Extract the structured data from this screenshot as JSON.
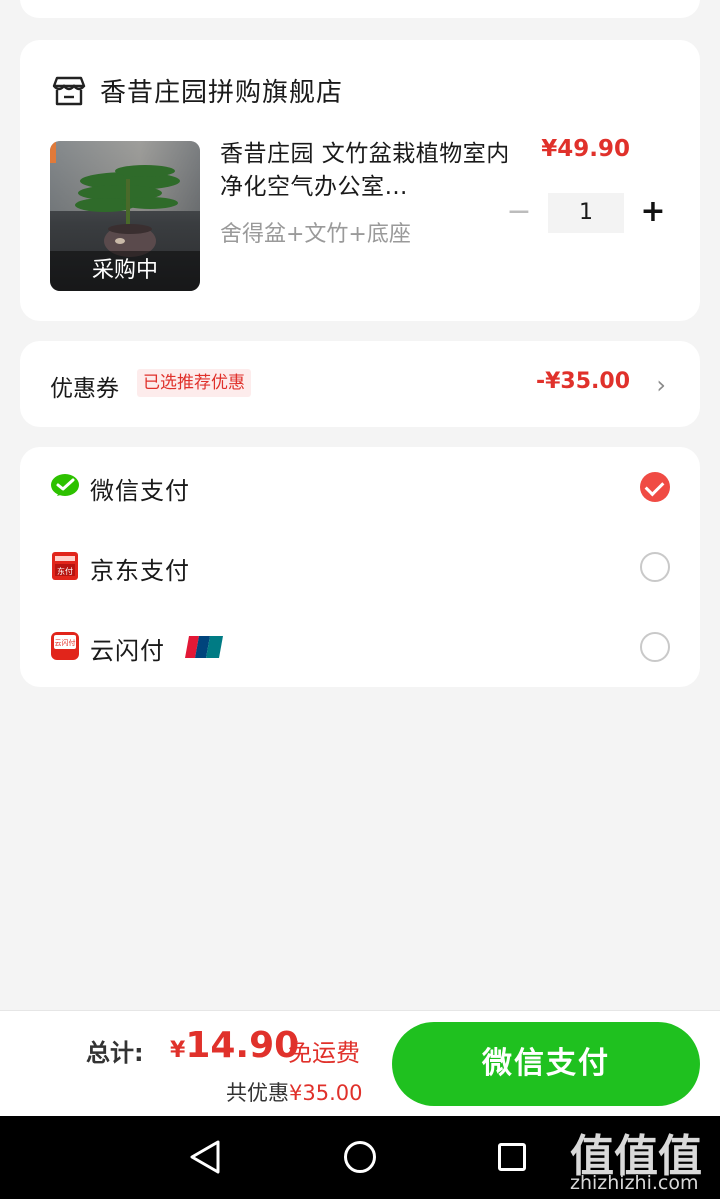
{
  "store": {
    "name": "香昔庄园拼购旗舰店",
    "product": {
      "title": "香昔庄园 文竹盆栽植物室内净化空气办公室…",
      "spec": "舍得盆+文竹+底座",
      "price": "¥49.90",
      "thumb_label": "采购中",
      "quantity": "1",
      "minus_symbol": "−",
      "plus_symbol": "+"
    }
  },
  "coupon": {
    "label": "优惠券",
    "badge": "已选推荐优惠",
    "amount": "-¥35.00",
    "chevron": "›"
  },
  "payment_methods": [
    {
      "label": "微信支付",
      "icon": "wechat-pay-icon",
      "selected": true
    },
    {
      "label": "京东支付",
      "icon": "jd-pay-icon",
      "selected": false
    },
    {
      "label": "云闪付",
      "icon": "cloud-quickpass-icon",
      "selected": false,
      "extra_icon": "unionpay-icon"
    }
  ],
  "footer": {
    "total_label": "总计:",
    "currency": "¥",
    "total_amount": "14.90",
    "free_shipping": "免运费",
    "saved_label": "共优惠",
    "saved_amount": "¥35.00",
    "pay_button": "微信支付"
  },
  "watermark": {
    "big": "值值值",
    "small": "zhizhizhi.com"
  },
  "colors": {
    "accent_red": "#e0312b",
    "pay_green": "#1fc11f",
    "wechat_green": "#2dc100"
  }
}
